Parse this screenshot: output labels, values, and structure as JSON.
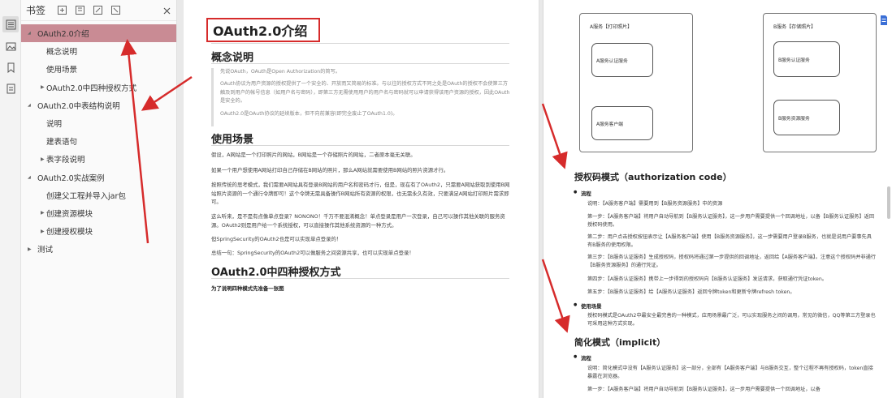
{
  "sidebar": {
    "title": "书签",
    "close_icon": "close-icon",
    "rail_icons": [
      "outline-icon",
      "image-icon",
      "bookmark-icon",
      "attachment-icon"
    ],
    "items": [
      {
        "label": "OAuth2.0介绍",
        "level": 0,
        "expanded": true,
        "selected": true
      },
      {
        "label": "概念说明",
        "level": 1,
        "expanded": null
      },
      {
        "label": "使用场景",
        "level": 1,
        "expanded": null
      },
      {
        "label": "OAuth2.0中四种授权方式",
        "level": 1,
        "expanded": false
      },
      {
        "label": "OAuth2.0中表结构说明",
        "level": 0,
        "expanded": true
      },
      {
        "label": "说明",
        "level": 1,
        "expanded": null
      },
      {
        "label": "建表语句",
        "level": 1,
        "expanded": null
      },
      {
        "label": "表字段说明",
        "level": 1,
        "expanded": false
      },
      {
        "label": "OAuth2.0实战案例",
        "level": 0,
        "expanded": true
      },
      {
        "label": "创建父工程并导入jar包",
        "level": 1,
        "expanded": null
      },
      {
        "label": "创建资源模块",
        "level": 1,
        "expanded": false
      },
      {
        "label": "创建授权模块",
        "level": 1,
        "expanded": false
      },
      {
        "label": "测试",
        "level": 0,
        "expanded": false
      }
    ]
  },
  "page1": {
    "title": "OAuth2.0介绍",
    "sec1": "概念说明",
    "q1": "先说OAuth，OAuth是Open Authorization的简写。",
    "q2": "OAuth协议为用户资源的授权提供了一个安全的、开放而又简易的标准。与以往的授权方式不同之处是OAuth的授权不会使第三方触及到用户的帐号信息（如用户名与密码），即第三方无需使用用户的用户名与密码就可以申请获得该用户资源的授权，因此OAuth是安全的。",
    "q3": "OAuth2.0是OAuth协议的延续版本，但不向前兼容(即完全废止了OAuth1.0)。",
    "sec2": "使用场景",
    "p1": "假设，A网站是一个打印照片的网站，B网站是一个存储照片的网站，二者原本毫无关联。",
    "p2": "如果一个用户想使用A网站打印自己存储在B网站的照片，那么A网站就需要使用B网站的照片资源才行。",
    "p3": "按照传统的思考模式，我们需要A网站具有登录B网站的用户名和密码才行，但是，现在有了OAuth2，只需要A网站获取到使用B网站照片资源的一个通行令牌即可！这个令牌无需具备操作B网站所有资源的权限，也无需永久有效，只要满足A网站打印照片需求即可。",
    "p4": "这么听来，是不是有点像单点登录？NONONO！千万不要混淆概念！单点登录是用户一次登录，自己可以操作其他关联的服务资源。OAuth2则是用户给一个系统授权，可以直接操作其他系统资源的一种方式。",
    "p5": "但SpringSecurity的OAuth2也是可以实现单点登录的！",
    "p6": "总结一句：SpringSecurity的OAuth2可以做服务之间资源共享，也可以实现单点登录！",
    "sec3": "OAuth2.0中四种授权方式",
    "note": "为了说明四种模式先准备一张图"
  },
  "page2": {
    "diagA": {
      "label": "A服务【打印照片】",
      "box1": "A服务认证服务",
      "box2": "A服务客户端"
    },
    "diagB": {
      "label": "B服务【存储照片】",
      "box1": "B服务认证服务",
      "box2": "B服务资源服务"
    },
    "h_auth": "授权码模式（authorization code）",
    "b_flow": "流程",
    "l1": "说明：【A服务客户端】需要用到【B服务资源服务】中的资源",
    "l2": "第一步：【A服务客户端】将用户自动导航到【B服务认证服务】，这一步用户需要提供一个回调地址，以备【B服务认证服务】返回授权码使用。",
    "l3": "第二步：用户点击授权按钮表示让【A服务客户端】使用【B服务资源服务】，这一步需要用户登录B服务，也就是说用户要事先具有B服务的使用权限。",
    "l4": "第三步：【B服务认证服务】生成授权码，授权码将通过第一步提供的回调地址，返回给【A服务客户端】。注意这个授权码并非通行【B服务资源服务】的通行凭证。",
    "l5": "第四步：【A服务认证服务】携带上一步得到的授权码向【B服务认证服务】发送请求，获取通行凭证token。",
    "l6": "第五步：【B服务认证服务】给【A服务认证服务】返回令牌token和更新令牌refresh token。",
    "b_scene": "使用场景",
    "scene": "授权码模式是OAuth2中最安全最完善的一种模式，应用场景最广泛，可以实现服务之间的调用，常见的微信，QQ等第三方登录也可采用这种方式实现。",
    "h_imp": "简化模式（implicit）",
    "b_flow2": "流程",
    "m1": "说明：简化模式中没有【A服务认证服务】这一部分，全部有【A服务客户端】与B服务交互，整个过程不再有授权码，token直接暴露在浏览器。",
    "m2": "第一步：【A服务客户端】将用户自动导航到【B服务认证服务】，这一步用户需要提供一个回调地址，以备"
  },
  "colors": {
    "highlight": "#c98b94",
    "annotation": "#d62b2b"
  }
}
